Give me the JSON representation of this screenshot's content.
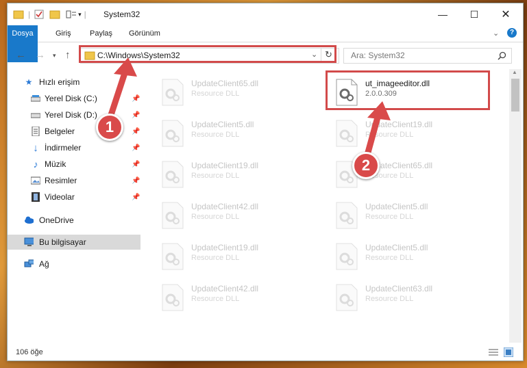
{
  "window": {
    "title": "System32"
  },
  "ribbon": {
    "tabs": [
      "Dosya",
      "Giriş",
      "Paylaş",
      "Görünüm"
    ]
  },
  "address": {
    "path": "C:\\Windows\\System32"
  },
  "search": {
    "placeholder": "Ara: System32"
  },
  "sidebar": {
    "items": [
      {
        "label": "Hızlı erişim",
        "icon": "star-icon"
      },
      {
        "label": "Yerel Disk (C:)",
        "icon": "drive-icon",
        "pinned": true
      },
      {
        "label": "Yerel Disk (D:)",
        "icon": "drive-icon",
        "pinned": true
      },
      {
        "label": "Belgeler",
        "icon": "documents-icon",
        "pinned": true
      },
      {
        "label": "İndirmeler",
        "icon": "download-icon",
        "pinned": true
      },
      {
        "label": "Müzik",
        "icon": "music-icon",
        "pinned": true
      },
      {
        "label": "Resimler",
        "icon": "pictures-icon",
        "pinned": true
      },
      {
        "label": "Videolar",
        "icon": "videos-icon",
        "pinned": true
      },
      {
        "label": "OneDrive",
        "icon": "cloud-icon"
      },
      {
        "label": "Bu bilgisayar",
        "icon": "computer-icon",
        "selected": true
      },
      {
        "label": "Ağ",
        "icon": "network-icon"
      }
    ]
  },
  "files": [
    {
      "name": "UpdateClient65.dll",
      "desc": "Resource DLL"
    },
    {
      "name": "ut_imageeditor.dll",
      "desc": "2.0.0.309",
      "highlighted": true
    },
    {
      "name": "UpdateClient5.dll",
      "desc": "Resource DLL"
    },
    {
      "name": "UpdateClient19.dll",
      "desc": "Resource DLL"
    },
    {
      "name": "UpdateClient19.dll",
      "desc": "Resource DLL"
    },
    {
      "name": "UpdateClient65.dll",
      "desc": "Resource DLL"
    },
    {
      "name": "UpdateClient42.dll",
      "desc": "Resource DLL"
    },
    {
      "name": "UpdateClient5.dll",
      "desc": "Resource DLL"
    },
    {
      "name": "UpdateClient19.dll",
      "desc": "Resource DLL"
    },
    {
      "name": "UpdateClient5.dll",
      "desc": "Resource DLL"
    },
    {
      "name": "UpdateClient42.dll",
      "desc": "Resource DLL"
    },
    {
      "name": "UpdateClient63.dll",
      "desc": "Resource DLL"
    }
  ],
  "status": {
    "count": "106 öğe"
  },
  "annotations": {
    "step1": "1",
    "step2": "2"
  },
  "colors": {
    "accent": "#1979ca",
    "highlight": "#d24a4a"
  }
}
